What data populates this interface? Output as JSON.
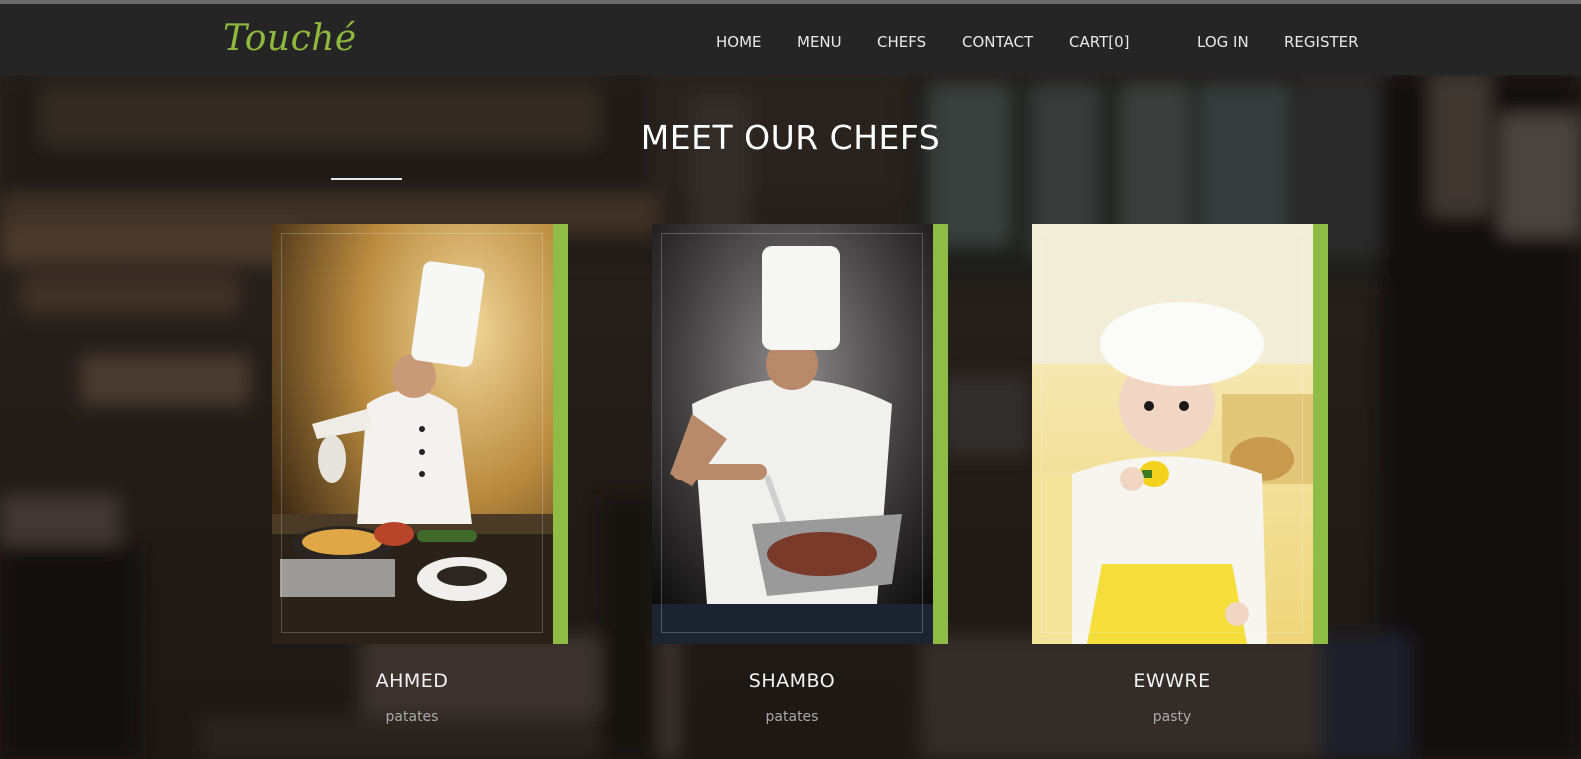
{
  "brand": {
    "logo": "Touché",
    "accent_color": "#8fbc45"
  },
  "nav": {
    "items": [
      {
        "label": "HOME"
      },
      {
        "label": "MENU"
      },
      {
        "label": "CHEFS"
      },
      {
        "label": "CONTACT"
      },
      {
        "label": "CART[0]"
      },
      {
        "label": "LOG IN"
      },
      {
        "label": "REGISTER"
      }
    ]
  },
  "section": {
    "title": "MEET OUR CHEFS"
  },
  "chefs": [
    {
      "name": "AHMED",
      "dish": "patates"
    },
    {
      "name": "SHAMBO",
      "dish": "patates"
    },
    {
      "name": "EWWRE",
      "dish": "pasty"
    }
  ]
}
